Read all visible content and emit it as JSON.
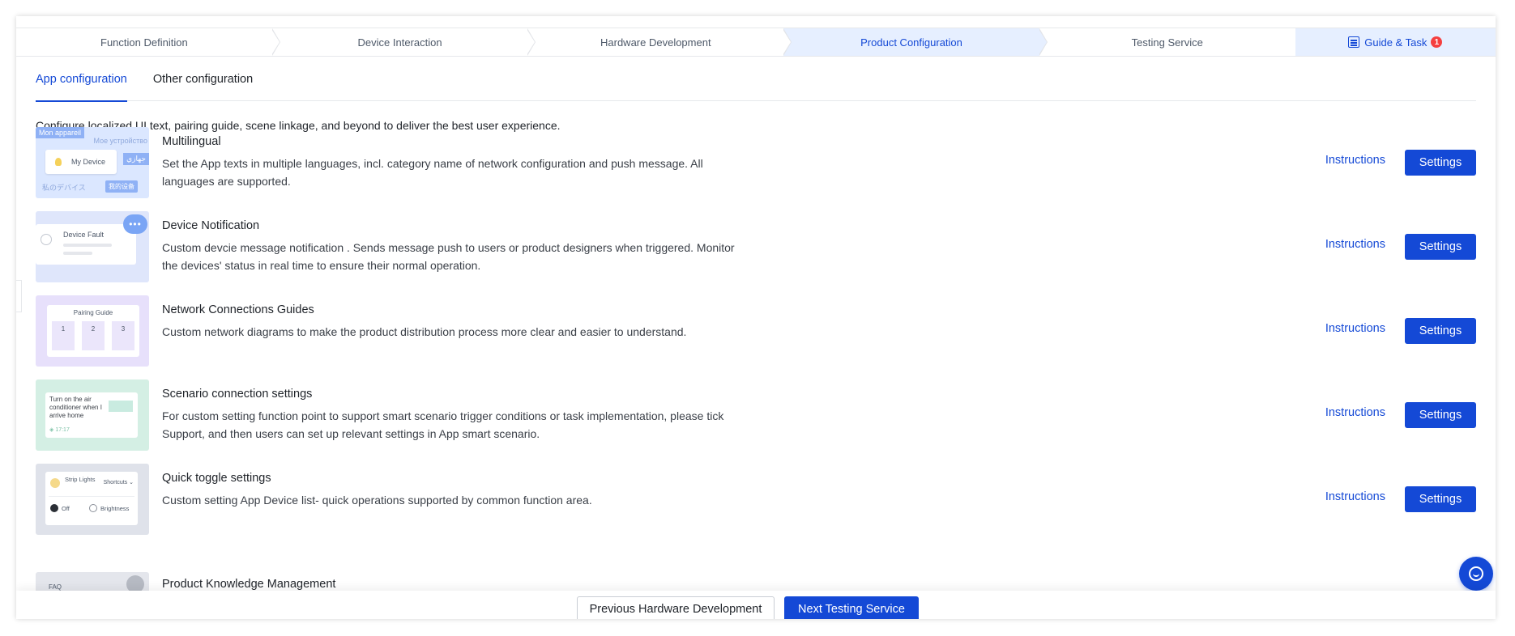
{
  "stepper": {
    "steps": [
      {
        "label": "Function Definition"
      },
      {
        "label": "Device Interaction"
      },
      {
        "label": "Hardware Development"
      },
      {
        "label": "Product Configuration"
      },
      {
        "label": "Testing Service"
      }
    ],
    "active_step": "Product Configuration",
    "guide_label": "Guide & Task",
    "guide_badge": "1"
  },
  "tabs": [
    {
      "label": "App configuration",
      "active": true
    },
    {
      "label": "Other configuration",
      "active": false
    }
  ],
  "intro": "Configure localized UI text, pairing guide, scene linkage, and beyond to deliver the best user experience.",
  "rows": [
    {
      "title": "Multilingual",
      "desc": "Set the App texts in multiple languages, incl. category name of network configuration and push message. All languages are supported.",
      "link": "Instructions",
      "button": "Settings"
    },
    {
      "title": "Device Notification",
      "desc": "Custom devcie message notification . Sends message push to users or product designers when triggered. Monitor the devices' status in real time to ensure their normal operation.",
      "link": "Instructions",
      "button": "Settings"
    },
    {
      "title": "Network Connections Guides",
      "desc": "Custom network diagrams to make the product distribution process more clear and easier to understand.",
      "link": "Instructions",
      "button": "Settings"
    },
    {
      "title": "Scenario connection settings",
      "desc": "For custom setting function point to support smart scenario trigger conditions or task implementation, please tick Support, and then users can set up relevant settings in App smart scenario.",
      "link": "Instructions",
      "button": "Settings"
    },
    {
      "title": "Quick toggle settings",
      "desc": "Custom setting App Device list- quick operations supported by common function area.",
      "link": "Instructions",
      "button": "Settings"
    },
    {
      "title": "Product Knowledge Management",
      "desc": "",
      "link": "",
      "button": ""
    }
  ],
  "thumbs": {
    "multilingual": {
      "badge": "Mon appareil",
      "ru": "Мое устройство",
      "device": "My Device",
      "ar": "جهازي",
      "jp": "私のデバイス",
      "cn": "我的设备"
    },
    "notification": {
      "label": "Device Fault",
      "bubble": "•••"
    },
    "pairing": {
      "label": "Pairing Guide",
      "steps": [
        "1",
        "2",
        "3"
      ]
    },
    "scenario": {
      "label": "Turn on the air conditioner when I arrive home",
      "small": "◈ 17:17"
    },
    "quick": {
      "name": "Strip Lights",
      "shortcuts": "Shortcuts ⌄",
      "off": "Off",
      "brightness": "Brightness"
    },
    "knowledge": {
      "label": "FAQ"
    }
  },
  "footer": {
    "prev": "Previous Hardware Development",
    "next": "Next Testing Service"
  },
  "colors": {
    "accent": "#1449d6",
    "active_step_bg": "#e6efff",
    "badge": "#f53f3f"
  }
}
